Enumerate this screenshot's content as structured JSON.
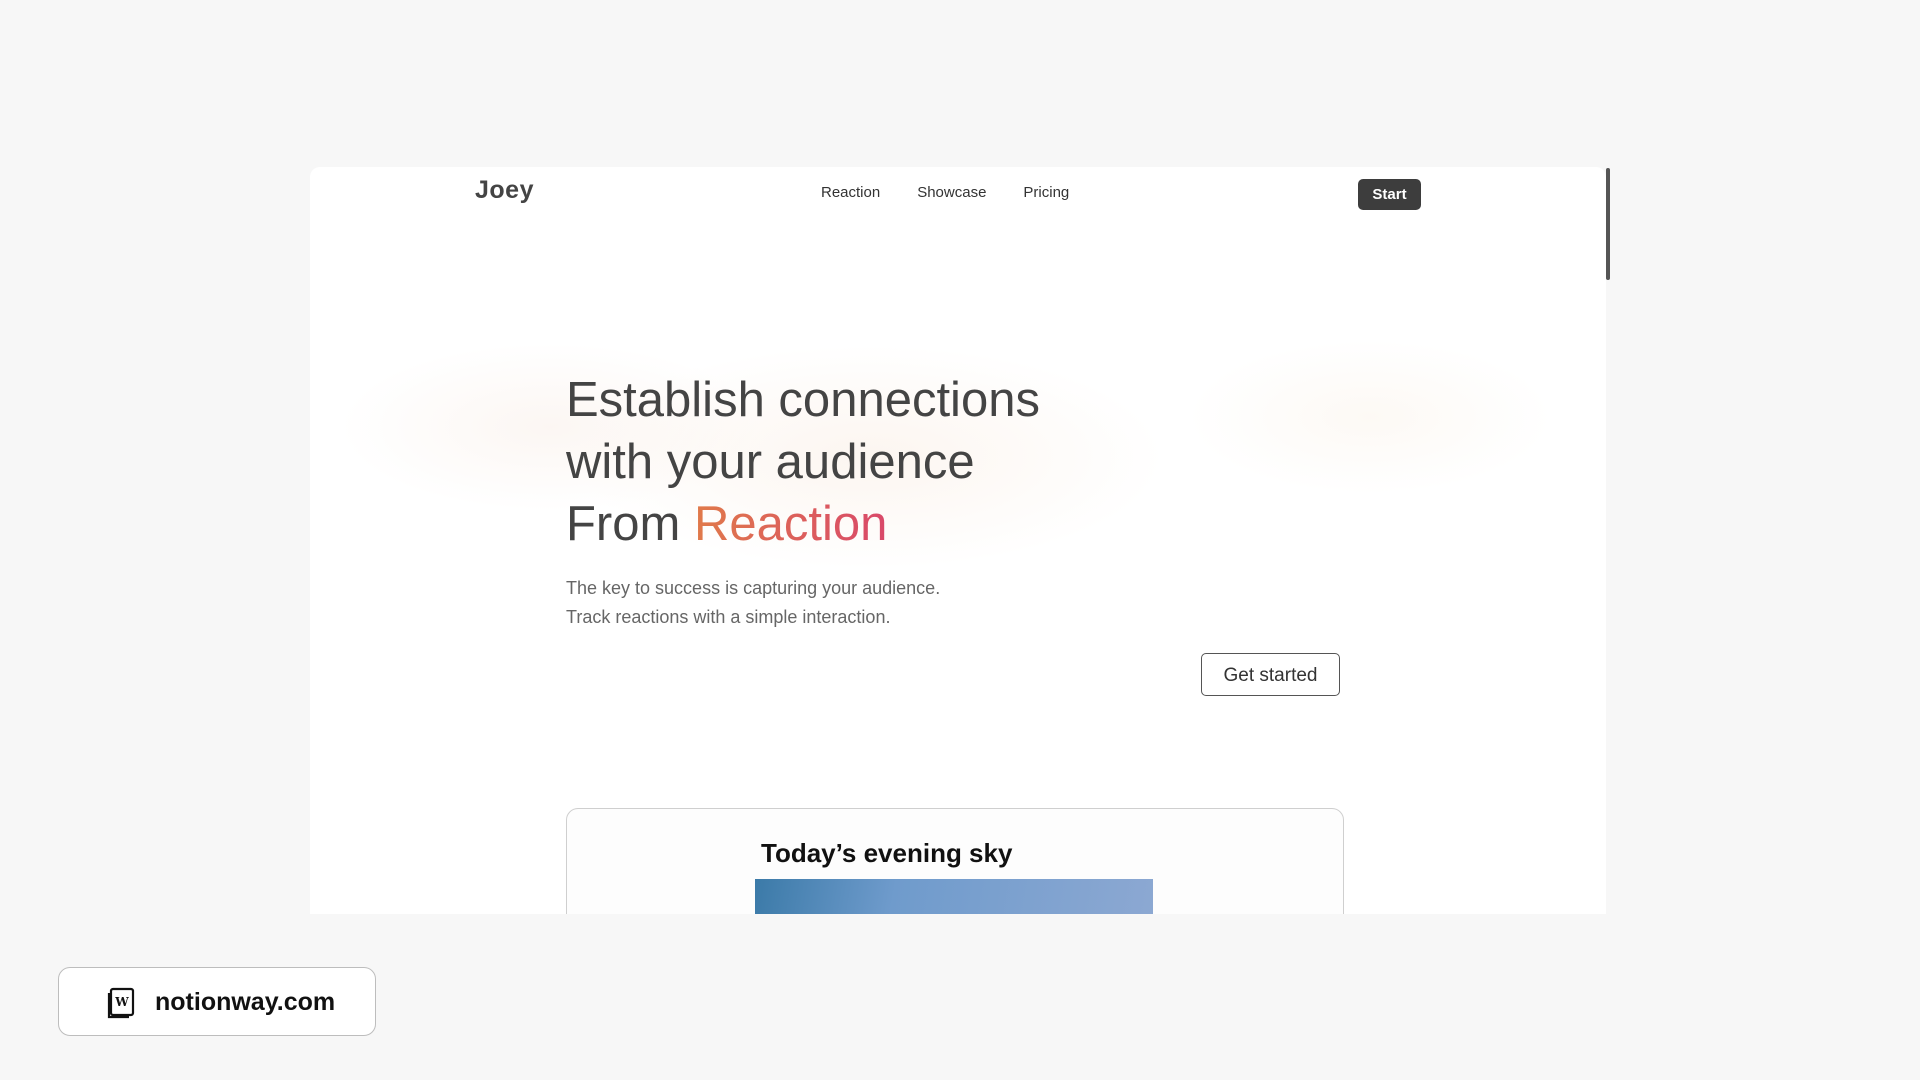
{
  "nav": {
    "logo": "Joey",
    "links": [
      "Reaction",
      "Showcase",
      "Pricing"
    ],
    "start_label": "Start"
  },
  "hero": {
    "line1": "Establish connections",
    "line2": "with your audience",
    "line3_prefix": "From ",
    "line3_accent": "Reaction",
    "sub1": "The key to success is capturing your audience.",
    "sub2": "Track reactions with a simple interaction.",
    "cta_label": "Get started"
  },
  "card": {
    "title": "Today’s evening sky"
  },
  "badge": {
    "text": "notionway.com",
    "icon": "notionway-logo-icon"
  },
  "colors": {
    "accent_start": "#e07a4a",
    "accent_end": "#d9486a",
    "button_dark": "#3d3d3d",
    "page_bg": "#f7f7f7"
  }
}
